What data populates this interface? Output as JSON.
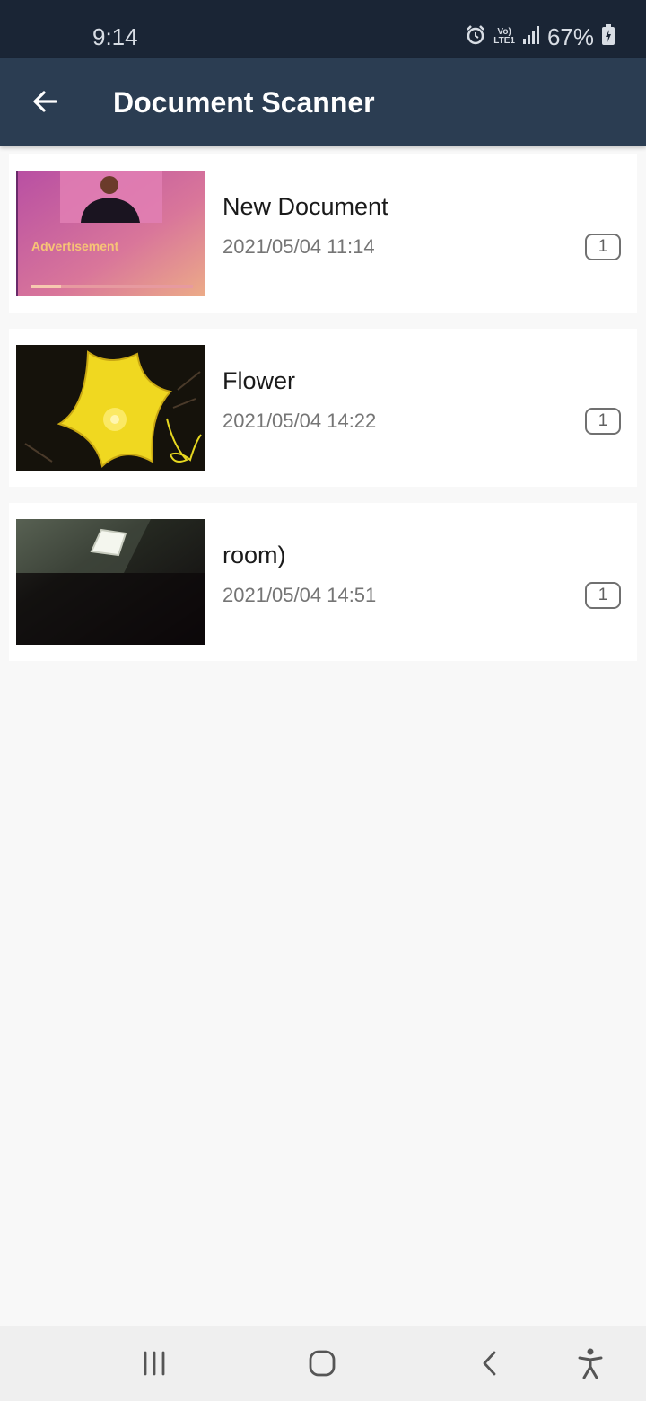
{
  "status_bar": {
    "time": "9:14",
    "network_top": "Vo)",
    "network_bottom": "LTE1",
    "battery": "67%",
    "icons": [
      "alarm-icon",
      "signal-icon",
      "battery-icon"
    ]
  },
  "app_bar": {
    "title": "Document Scanner",
    "back_icon": "arrow-left-icon"
  },
  "documents": [
    {
      "title": "New Document",
      "date": "2021/05/04 11:14",
      "pages": "1",
      "thumbnail_text": "Advertisement"
    },
    {
      "title": "Flower",
      "date": "2021/05/04 14:22",
      "pages": "1"
    },
    {
      "title": "room)",
      "date": "2021/05/04 14:51",
      "pages": "1"
    }
  ],
  "nav_bar": {
    "icons": [
      "recent-apps-icon",
      "home-icon",
      "back-icon",
      "accessibility-icon"
    ]
  },
  "colors": {
    "status_bar": "#1a2535",
    "app_bar": "#2b3d52",
    "background": "#f8f8f8"
  }
}
